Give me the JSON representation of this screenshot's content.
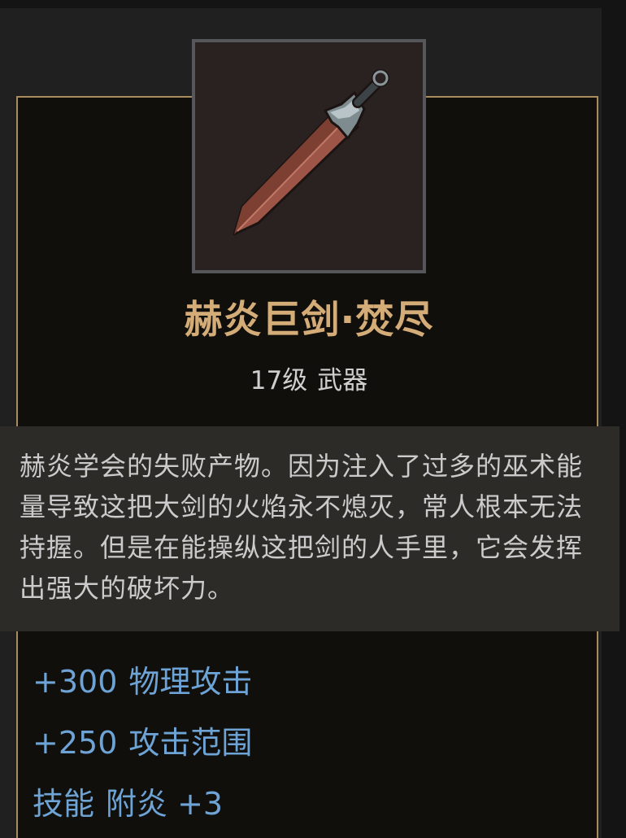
{
  "item": {
    "name": "赫炎巨剑·焚尽",
    "level": "17级",
    "category": "武器",
    "description": "赫炎学会的失败产物。因为注入了过多的巫术能量导致这把大剑的火焰永不熄灭，常人根本无法持握。但是在能操纵这把剑的人手里，它会发挥出强大的破坏力。",
    "icon": "greatsword-icon"
  },
  "stats": [
    {
      "value": "+300",
      "label": "物理攻击"
    },
    {
      "value": "+250",
      "label": "攻击范围"
    },
    {
      "value": "技能",
      "label": "附炎 +3"
    }
  ],
  "colors": {
    "name": "#d4ac78",
    "stat": "#6ea3d6",
    "border": "#a88b5e",
    "tooltip_bg": "#2c2b28"
  }
}
